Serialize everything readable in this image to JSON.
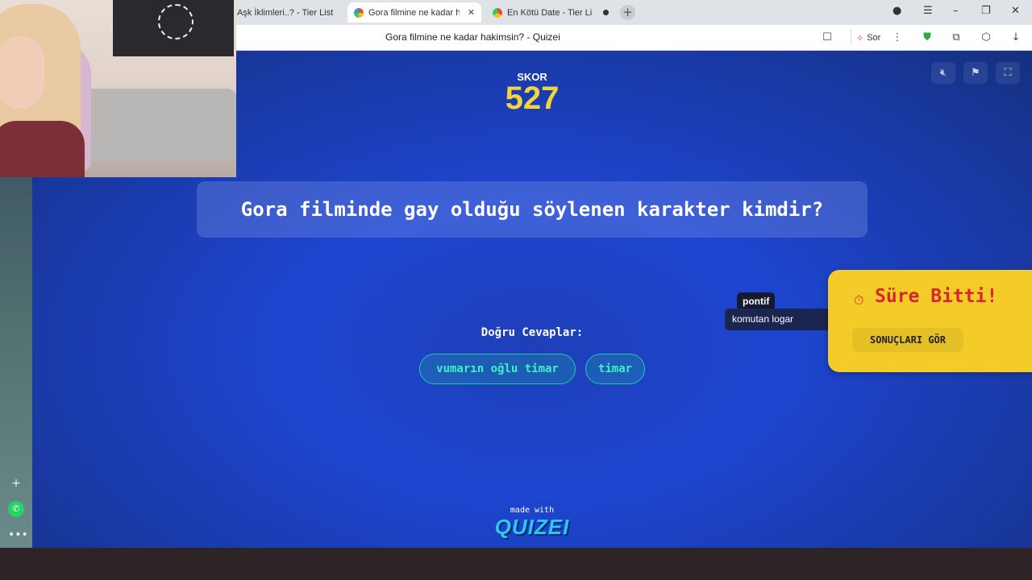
{
  "browser": {
    "tabs": [
      {
        "label": "Aşk İklimleri..? - Tier List"
      },
      {
        "label": "Gora filmine ne kadar hakimsin? - Quizei"
      },
      {
        "label": "En Kötü Date - Tier List"
      }
    ],
    "page_title": "Gora filmine ne kadar hakimsin? - Quizei",
    "sor_label": "Sor"
  },
  "quiz": {
    "score_label": "SKOR",
    "score_value": "527",
    "question": "Gora filminde gay olduğu söylenen karakter kimdir?",
    "answers_label": "Doğru Cevaplar:",
    "answers": [
      "vumarın oğlu timar",
      "timar"
    ],
    "made_with": "made with",
    "brand": "QUIZEI"
  },
  "player": {
    "tag": "pontif",
    "answer": "komutan logar"
  },
  "time_up": {
    "title": "Süre Bitti!",
    "button": "SONUÇLARI GÖR"
  },
  "colors": {
    "score": "#f5d33b",
    "answer_pill": "#3ff0c8",
    "time_up_bg": "#f4cc2a",
    "time_up_text": "#d8262d"
  }
}
